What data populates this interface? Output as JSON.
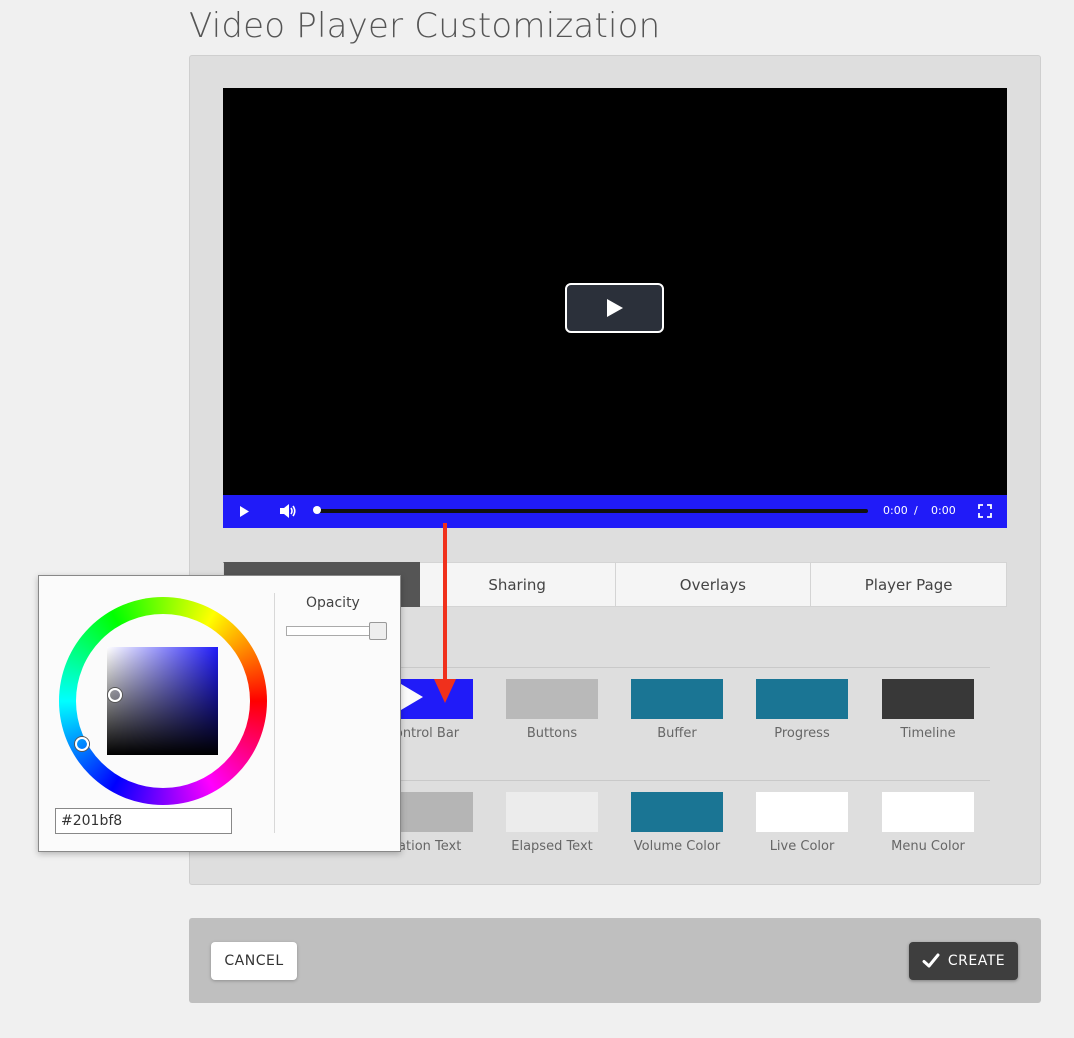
{
  "page": {
    "title": "Video Player Customization"
  },
  "player": {
    "control_bar_color": "#201bf8",
    "current_time": "0:00",
    "time_separator": "/",
    "duration": "0:00",
    "icons": {
      "big_play": "play-icon",
      "play": "play-icon",
      "volume": "volume-icon",
      "fullscreen": "fullscreen-icon"
    }
  },
  "tabs": [
    {
      "label": "",
      "active": true
    },
    {
      "label": "Sharing",
      "active": false
    },
    {
      "label": "Overlays",
      "active": false
    },
    {
      "label": "Player Page",
      "active": false
    }
  ],
  "swatches_row1": [
    {
      "label": "ontrol Bar",
      "color": "#201bf8"
    },
    {
      "label": "Buttons",
      "color": "#b9b9b9"
    },
    {
      "label": "Buffer",
      "color": "#1a7594"
    },
    {
      "label": "Progress",
      "color": "#1a7594"
    },
    {
      "label": "Timeline",
      "color": "#383838"
    }
  ],
  "swatches_row2": [
    {
      "label": "ration Text",
      "color": "#b5b5b5"
    },
    {
      "label": "Elapsed Text",
      "color": "#ececec"
    },
    {
      "label": "Volume Color",
      "color": "#1a7594"
    },
    {
      "label": "Live Color",
      "color": "#ffffff"
    },
    {
      "label": "Menu Color",
      "color": "#ffffff"
    }
  ],
  "color_picker": {
    "hex_value": "#201bf8",
    "opacity_label": "Opacity",
    "opacity_value": 1
  },
  "footer": {
    "cancel_label": "CANCEL",
    "create_label": "CREATE",
    "create_icon": "checkmark-icon"
  }
}
